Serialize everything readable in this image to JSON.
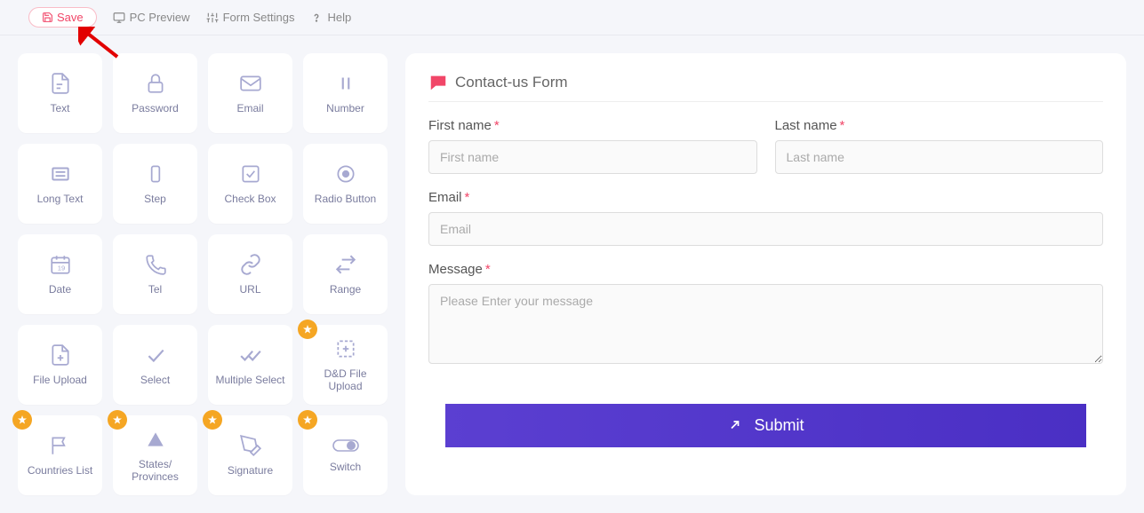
{
  "topbar": {
    "save": "Save",
    "pc_preview": "PC Preview",
    "form_settings": "Form Settings",
    "help": "Help"
  },
  "palette": [
    {
      "id": "text",
      "label": "Text",
      "icon": "file-icon",
      "premium": false
    },
    {
      "id": "password",
      "label": "Password",
      "icon": "lock-icon",
      "premium": false
    },
    {
      "id": "email",
      "label": "Email",
      "icon": "mail-icon",
      "premium": false
    },
    {
      "id": "number",
      "label": "Number",
      "icon": "pause-icon",
      "premium": false
    },
    {
      "id": "long-text",
      "label": "Long Text",
      "icon": "lines-icon",
      "premium": false
    },
    {
      "id": "step",
      "label": "Step",
      "icon": "device-icon",
      "premium": false
    },
    {
      "id": "checkbox",
      "label": "Check Box",
      "icon": "check-square-icon",
      "premium": false
    },
    {
      "id": "radio",
      "label": "Radio Button",
      "icon": "radio-icon",
      "premium": false
    },
    {
      "id": "date",
      "label": "Date",
      "icon": "calendar-icon",
      "premium": false
    },
    {
      "id": "tel",
      "label": "Tel",
      "icon": "phone-icon",
      "premium": false
    },
    {
      "id": "url",
      "label": "URL",
      "icon": "link-icon",
      "premium": false
    },
    {
      "id": "range",
      "label": "Range",
      "icon": "swap-icon",
      "premium": false
    },
    {
      "id": "file-upload",
      "label": "File Upload",
      "icon": "file-plus-icon",
      "premium": false
    },
    {
      "id": "select",
      "label": "Select",
      "icon": "check-icon",
      "premium": false
    },
    {
      "id": "multi-select",
      "label": "Multiple Select",
      "icon": "double-check-icon",
      "premium": false
    },
    {
      "id": "dnd-file",
      "label": "D&D File Upload",
      "icon": "dashed-plus-icon",
      "premium": true
    },
    {
      "id": "countries",
      "label": "Countries List",
      "icon": "flag-icon",
      "premium": true
    },
    {
      "id": "states",
      "label": "States/ Provinces",
      "icon": "triangle-icon",
      "premium": true
    },
    {
      "id": "signature",
      "label": "Signature",
      "icon": "pen-icon",
      "premium": true
    },
    {
      "id": "switch",
      "label": "Switch",
      "icon": "toggle-icon",
      "premium": true
    }
  ],
  "form": {
    "title": "Contact-us Form",
    "fields": {
      "first_name": {
        "label": "First name",
        "placeholder": "First name",
        "required": true
      },
      "last_name": {
        "label": "Last name",
        "placeholder": "Last name",
        "required": true
      },
      "email": {
        "label": "Email",
        "placeholder": "Email",
        "required": true
      },
      "message": {
        "label": "Message",
        "placeholder": "Please Enter your message",
        "required": true
      }
    },
    "submit": "Submit"
  },
  "colors": {
    "accent": "#f14668",
    "submit": "#4a2fc4",
    "badge": "#f5a623",
    "icon": "#a7a9d1"
  }
}
